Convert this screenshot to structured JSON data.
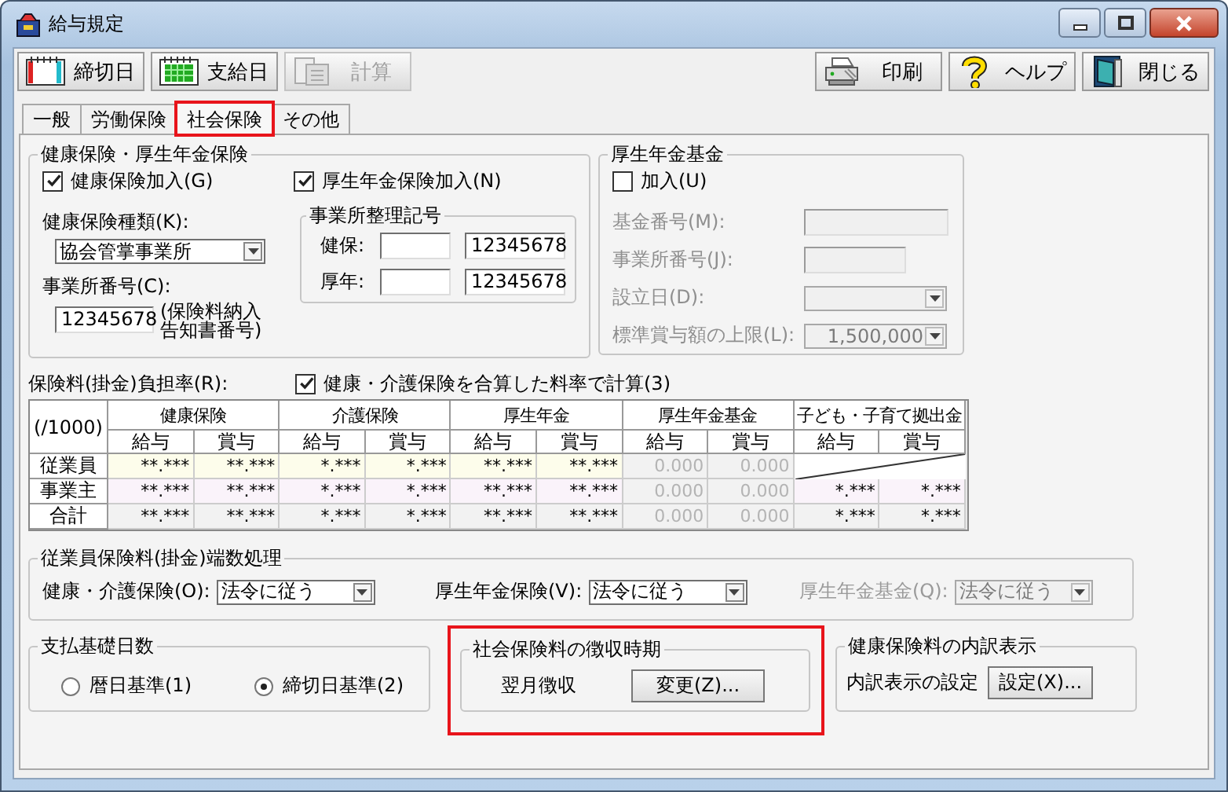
{
  "window": {
    "title": "給与規定"
  },
  "toolbar_left": [
    {
      "label": "締切日",
      "disabled": false
    },
    {
      "label": "支給日",
      "disabled": false
    },
    {
      "label": "計算",
      "disabled": true
    }
  ],
  "toolbar_right": [
    {
      "label": "印刷",
      "disabled": false
    },
    {
      "label": "ヘルプ",
      "disabled": false
    },
    {
      "label": "閉じる",
      "disabled": false
    }
  ],
  "tabs": [
    {
      "label": "一般",
      "selected": false,
      "highlighted": false
    },
    {
      "label": "労働保険",
      "selected": false,
      "highlighted": false
    },
    {
      "label": "社会保険",
      "selected": true,
      "highlighted": true
    },
    {
      "label": "その他",
      "selected": false,
      "highlighted": false
    }
  ],
  "health_pension": {
    "title": "健康保険・厚生年金保険",
    "enrollment": [
      {
        "label": "健康保険加入(G)",
        "checked": true
      },
      {
        "label": "厚生年金保険加入(N)",
        "checked": true
      }
    ],
    "insurance_type": {
      "label": "健康保険種類(K):",
      "value": "協会管掌事業所"
    },
    "office_number": {
      "label": "事業所番号(C):",
      "value": "12345678",
      "note": "(保険料納入告知書番号)"
    },
    "office_code": {
      "title": "事業所整理記号",
      "rows": [
        {
          "label": "健保:",
          "number": "12345678"
        },
        {
          "label": "厚年:",
          "number": "12345678"
        }
      ]
    }
  },
  "pension_fund": {
    "title": "厚生年金基金",
    "join": {
      "label": "加入(U)",
      "checked": false
    },
    "disabled": true,
    "fields": [
      {
        "label": "基金番号(M):",
        "kind": "text"
      },
      {
        "label": "事業所番号(J):",
        "kind": "short-text"
      },
      {
        "label": "設立日(D):",
        "kind": "select"
      },
      {
        "label": "標準賞与額の上限(L):",
        "kind": "select",
        "value": "1,500,000"
      }
    ]
  },
  "rates": {
    "label": "保険料(掛金)負担率(R):",
    "combined": {
      "label": "健康・介護保険を合算した料率で計算(3)",
      "checked": true
    },
    "unit": "(/1000)",
    "groups": [
      {
        "name": "健康保険",
        "disabled": false,
        "columns": [
          "給与",
          "賞与"
        ]
      },
      {
        "name": "介護保険",
        "disabled": false,
        "columns": [
          "給与",
          "賞与"
        ]
      },
      {
        "name": "厚生年金",
        "disabled": false,
        "columns": [
          "給与",
          "賞与"
        ]
      },
      {
        "name": "厚生年金基金",
        "disabled": true,
        "columns": [
          "給与",
          "賞与"
        ]
      },
      {
        "name": "子ども・子育て拠出金",
        "disabled": false,
        "columns": [
          "給与",
          "賞与"
        ]
      }
    ],
    "rows": [
      {
        "label": "従業員",
        "kind": "employee",
        "cells": [
          "**.***",
          "**.***",
          "*.***",
          "*.***",
          "**.***",
          "**.***",
          "0.000",
          "0.000"
        ]
      },
      {
        "label": "事業主",
        "kind": "employer",
        "cells": [
          "**.***",
          "**.***",
          "*.***",
          "*.***",
          "**.***",
          "**.***",
          "0.000",
          "0.000",
          "*.***",
          "*.***"
        ]
      },
      {
        "label": "合計",
        "kind": "total",
        "cells": [
          "**.***",
          "**.***",
          "*.***",
          "*.***",
          "**.***",
          "**.***",
          "0.000",
          "0.000",
          "*.***",
          "*.***"
        ]
      }
    ]
  },
  "rounding": {
    "title": "従業員保険料(掛金)端数処理",
    "selects": [
      {
        "label": "健康・介護保険(O):",
        "value": "法令に従う",
        "disabled": false
      },
      {
        "label": "厚生年金保険(V):",
        "value": "法令に従う",
        "disabled": false
      },
      {
        "label": "厚生年金基金(Q):",
        "value": "法令に従う",
        "disabled": true
      }
    ]
  },
  "payment_days": {
    "title": "支払基礎日数",
    "options": [
      {
        "label": "暦日基準(1)",
        "selected": false
      },
      {
        "label": "締切日基準(2)",
        "selected": true
      }
    ]
  },
  "collection": {
    "title": "社会保険料の徴収時期",
    "value": "翌月徴収",
    "button": "変更(Z)...",
    "highlighted": true
  },
  "breakdown": {
    "title": "健康保険料の内訳表示",
    "label": "内訳表示の設定",
    "button": "設定(X)..."
  }
}
